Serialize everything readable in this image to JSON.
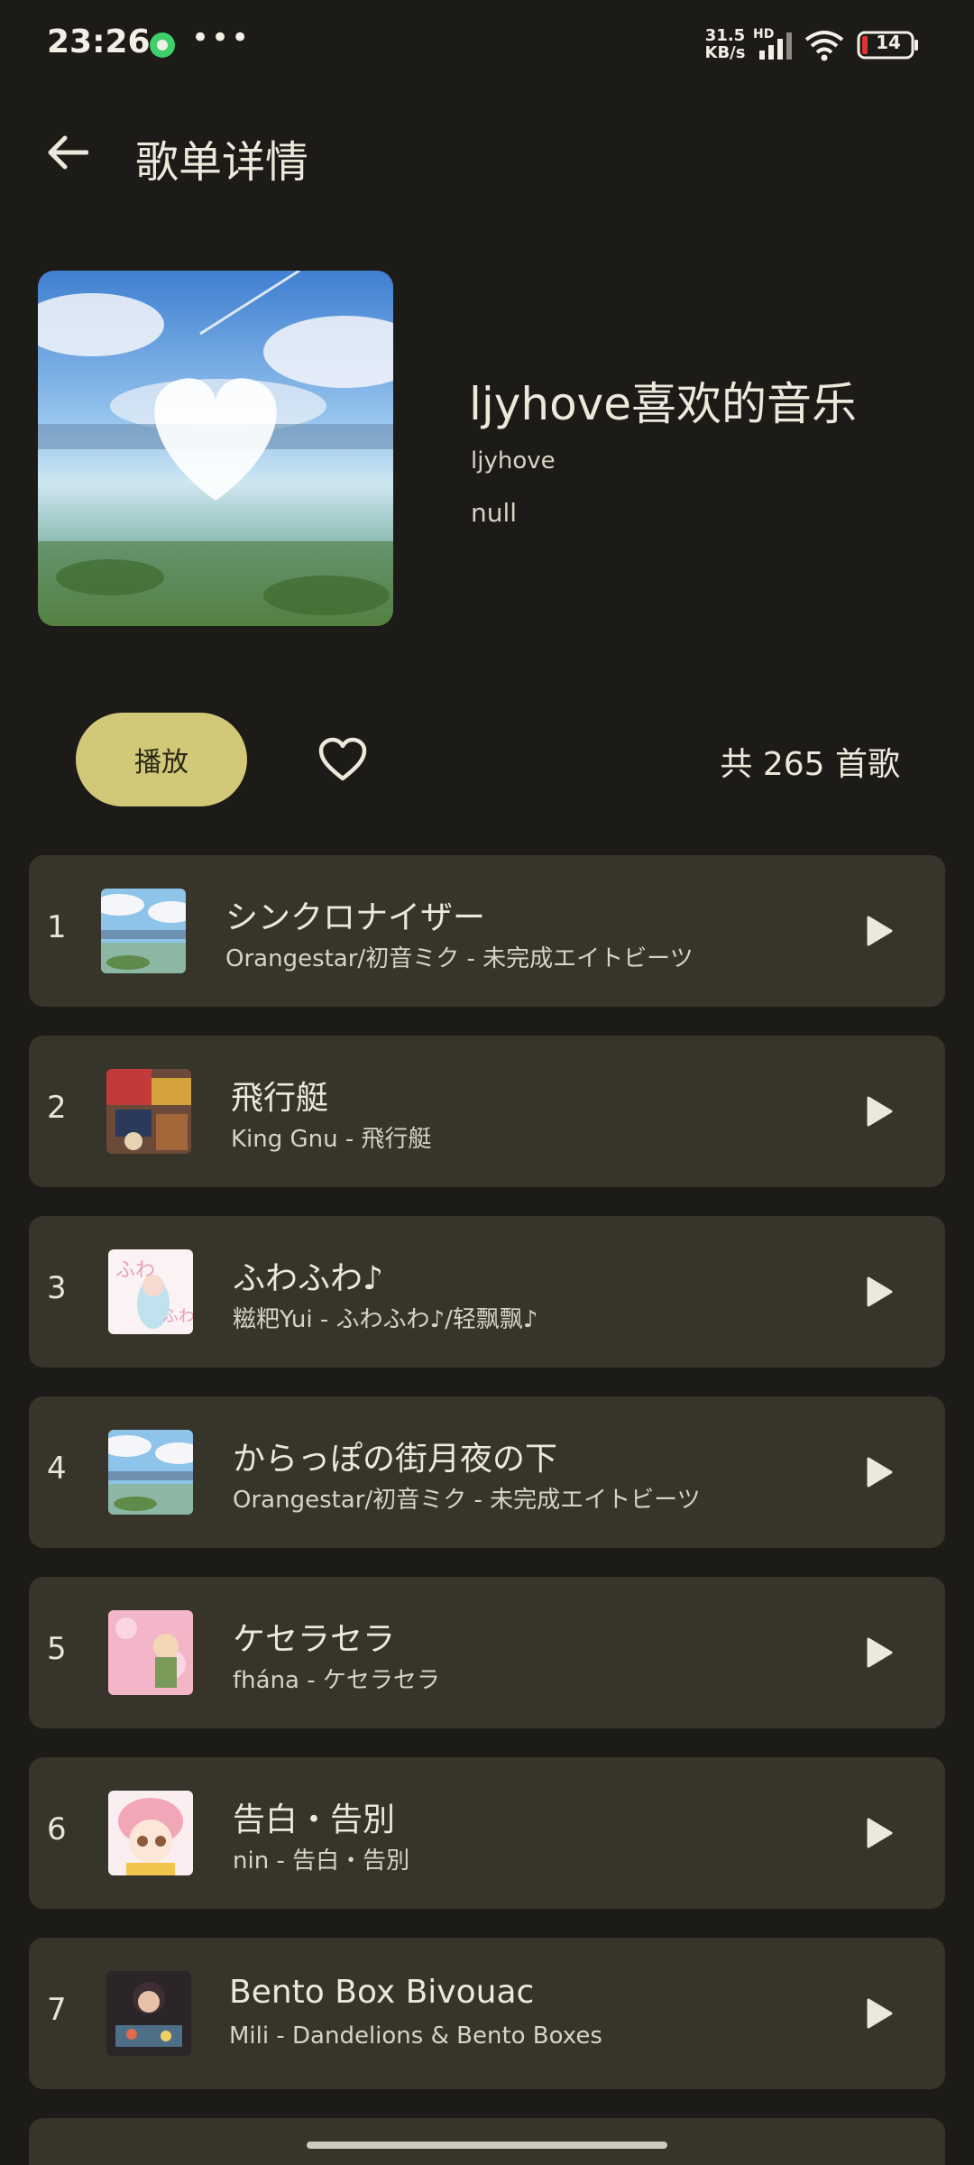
{
  "status_bar": {
    "time": "23:26",
    "dots": "•••",
    "net_speed": "31.5 KB/s",
    "hd": "HD",
    "battery": "14",
    "icons": [
      "app-notification-icon",
      "signal-icon",
      "wifi-icon",
      "battery-icon"
    ]
  },
  "header": {
    "back_icon": "arrow-left-icon",
    "title": "歌单详情"
  },
  "playlist": {
    "name": "ljyhove喜欢的音乐",
    "creator": "ljyhove",
    "description": "null"
  },
  "actions": {
    "play_label": "播放",
    "favorite_icon": "heart-outline-icon",
    "song_count": "共 265 首歌"
  },
  "songs": [
    {
      "index": "1",
      "title": "シンクロナイザー",
      "subtitle": "Orangestar/初音ミク - 未完成エイトビーツ"
    },
    {
      "index": "2",
      "title": "飛行艇",
      "subtitle": "King Gnu - 飛行艇"
    },
    {
      "index": "3",
      "title": "ふわふわ♪",
      "subtitle": "糍粑Yui - ふわふわ♪/轻飘飘♪"
    },
    {
      "index": "4",
      "title": "からっぽの街月夜の下",
      "subtitle": "Orangestar/初音ミク - 未完成エイトビーツ"
    },
    {
      "index": "5",
      "title": "ケセラセラ",
      "subtitle": "fhána - ケセラセラ"
    },
    {
      "index": "6",
      "title": "告白・告別",
      "subtitle": "nin - 告白・告別"
    },
    {
      "index": "7",
      "title": "Bento Box Bivouac",
      "subtitle": "Mili - Dandelions & Bento Boxes"
    }
  ],
  "colors": {
    "background": "#1c1b17",
    "card": "#37342a",
    "accent": "#d1c878",
    "text": "#ece8db"
  }
}
